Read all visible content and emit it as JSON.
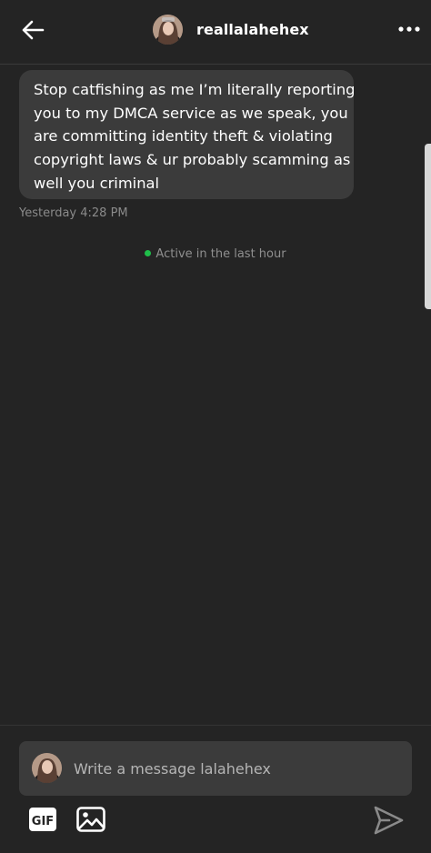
{
  "header": {
    "username": "reallalahehex",
    "back_icon": "arrow-left-icon",
    "more_icon": "more-horizontal-icon"
  },
  "messages": [
    {
      "lines": [
        "Stop catfishing as me I’m literally reporting",
        "you to my DMCA service as we speak, you",
        "are committing identity theft & violating",
        "copyright laws & ur probably scamming as",
        "well you criminal"
      ],
      "timestamp": "Yesterday 4:28 PM"
    }
  ],
  "status": {
    "text": "Active in the last hour",
    "dot_color": "#1fbf4a"
  },
  "composer": {
    "placeholder": "Write a message lalahehex",
    "gif_icon": "gif-icon",
    "image_icon": "image-icon",
    "send_icon": "send-icon"
  },
  "colors": {
    "background": "#242424",
    "bubble": "#3b3b3b",
    "text": "#ffffff",
    "muted": "#8a8a8a"
  }
}
